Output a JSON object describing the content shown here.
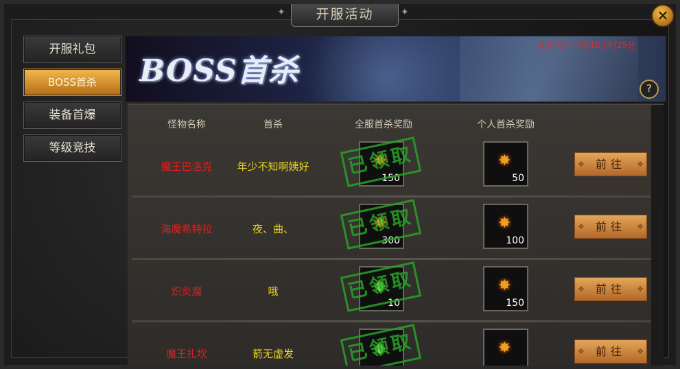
{
  "window": {
    "title": "开服活动",
    "close_label": "×"
  },
  "sidebar": {
    "items": [
      {
        "label": "开服礼包",
        "active": false
      },
      {
        "label": "BOSS首杀",
        "active": true
      },
      {
        "label": "装备首爆",
        "active": false
      },
      {
        "label": "等级竞技",
        "active": false
      }
    ]
  },
  "banner": {
    "title": "BOSS首杀",
    "remaining_time": "剩余时间: 7天10小时25分",
    "help_label": "?"
  },
  "table": {
    "headers": [
      "怪物名称",
      "首杀",
      "全服首杀奖励",
      "个人首杀奖励"
    ],
    "claimed_stamp": "已领取",
    "go_label": "前往",
    "rows": [
      {
        "monster": "魔王巴洛克",
        "first_killer": "年少不知啊姨好",
        "server_reward": {
          "icon": "gold-gem-icon",
          "count": "150"
        },
        "personal_reward": {
          "icon": "gold-gem-icon",
          "count": "50"
        }
      },
      {
        "monster": "海魔希特拉",
        "first_killer": "夜、曲、",
        "server_reward": {
          "icon": "gold-gem-icon",
          "count": "300"
        },
        "personal_reward": {
          "icon": "gold-gem-icon",
          "count": "100"
        }
      },
      {
        "monster": "炽炎魔",
        "first_killer": "哦",
        "server_reward": {
          "icon": "green-gem-icon",
          "count": "10"
        },
        "personal_reward": {
          "icon": "gold-gem-icon",
          "count": "150"
        }
      },
      {
        "monster": "魔王扎坎",
        "first_killer": "箭无虚发",
        "server_reward": {
          "icon": "green-gem-icon",
          "count": ""
        },
        "personal_reward": {
          "icon": "gold-gem-icon",
          "count": ""
        }
      }
    ]
  }
}
